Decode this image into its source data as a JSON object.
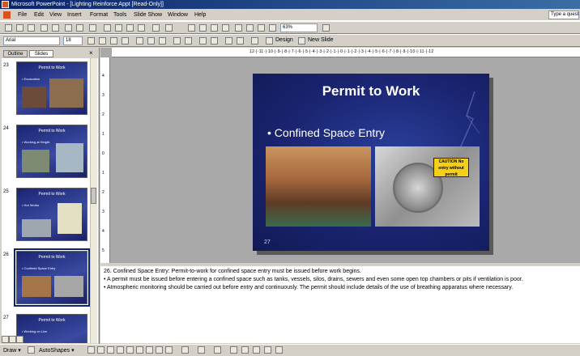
{
  "window": {
    "title": "Microsoft PowerPoint - [Lighting Reinforce Appt [Read-Only]]"
  },
  "menu": [
    "File",
    "Edit",
    "View",
    "Insert",
    "Format",
    "Tools",
    "Slide Show",
    "Window",
    "Help"
  ],
  "help_box": {
    "placeholder": "Type a question for help"
  },
  "toolbar": {
    "zoom": "63%",
    "font_name": "Arial",
    "font_size": "18",
    "design_label": "Design",
    "new_slide_label": "New Slide"
  },
  "left_pane": {
    "tabs": [
      "Outline",
      "Slides"
    ],
    "slides": [
      {
        "num": "23",
        "title": "Permit to Work",
        "bullet": "• Excavation"
      },
      {
        "num": "24",
        "title": "Permit to Work",
        "bullet": "• Working at Height"
      },
      {
        "num": "25",
        "title": "Permit to Work",
        "bullet": "• Hot Works"
      },
      {
        "num": "26",
        "title": "Permit to Work",
        "bullet": "• Confined Space Entry"
      },
      {
        "num": "27",
        "title": "Permit to Work",
        "bullet": "• Working on Live"
      }
    ]
  },
  "ruler": {
    "ticks": "12·|·11·|·10·|·9·|·8·|·7·|·6·|·5·|·4·|·3·|·2·|·1·|·0·|·1·|·2·|·3·|·4·|·5·|·6·|·7·|·8·|·9·|·10·|·11·|·12"
  },
  "slide": {
    "title": "Permit to Work",
    "bullet": "• Confined Space Entry",
    "caution_text": "CAUTION\nNo entry without permit",
    "slide_number": "27"
  },
  "notes": [
    "26. Confined Space Entry: Permit-to-work for confined space entry must be issued before work begins.",
    "• A permit must be issued before entering a confined space such as tanks, vessels, silos, drains, sewers and even some open top chambers or pits if ventilation is poor.",
    "• Atmospheric monitoring should be carried out before entry and continuously. The permit should include details of the use of breathing apparatus where necessary."
  ],
  "drawbar": {
    "draw_label": "Draw ▾",
    "autoshapes_label": "AutoShapes ▾"
  },
  "colors": {
    "title_bar": "#0a246a",
    "slide_bg": "#1a2470",
    "caution": "#f5cf18"
  }
}
